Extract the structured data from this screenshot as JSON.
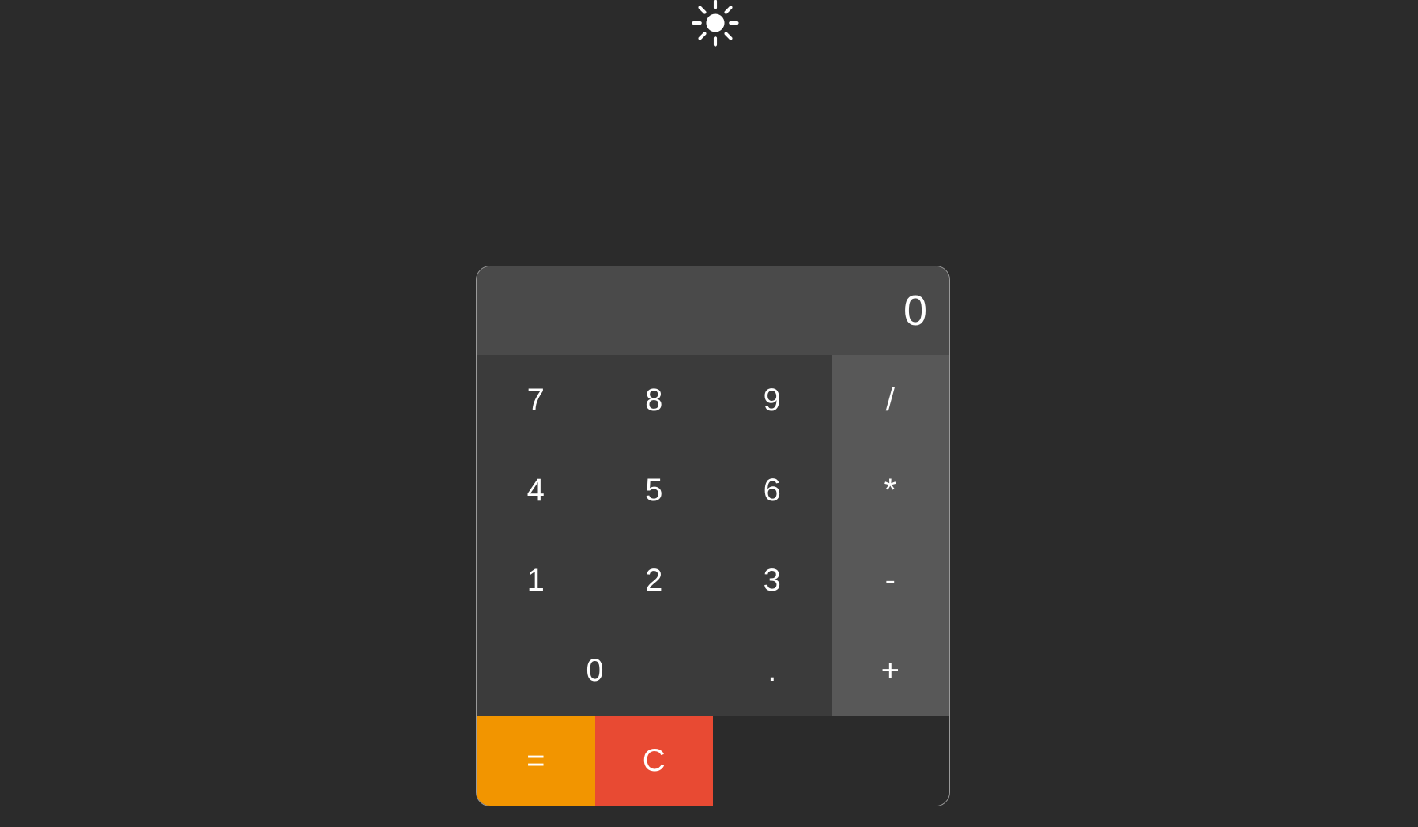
{
  "theme_icon": "sun-icon",
  "display_value": "0",
  "keys": {
    "k7": "7",
    "k8": "8",
    "k9": "9",
    "div": "/",
    "k4": "4",
    "k5": "5",
    "k6": "6",
    "mul": "*",
    "k1": "1",
    "k2": "2",
    "k3": "3",
    "sub": "-",
    "k0": "0",
    "dot": ".",
    "add": "+",
    "eq": "=",
    "clr": "C"
  },
  "colors": {
    "bg": "#2b2b2b",
    "display_bg": "#4a4a4a",
    "num_bg": "#3b3b3b",
    "op_bg": "#585858",
    "eq_bg": "#f29500",
    "clr_bg": "#e84a33",
    "border": "#9a9a9a",
    "text": "#ffffff"
  }
}
